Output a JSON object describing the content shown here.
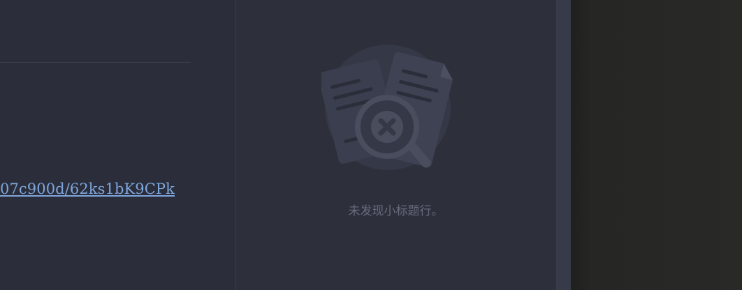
{
  "editor": {
    "link_text": "07c900d/62ks1bK9CPk"
  },
  "outline_panel": {
    "empty_message": "未发现小标题行。",
    "empty_icon": "no-results-icon"
  },
  "colors": {
    "panel_bg": "#2d2f3b",
    "link": "#7ea6dd",
    "muted_text": "#676b7c",
    "right_pane_bg": "#292927"
  }
}
